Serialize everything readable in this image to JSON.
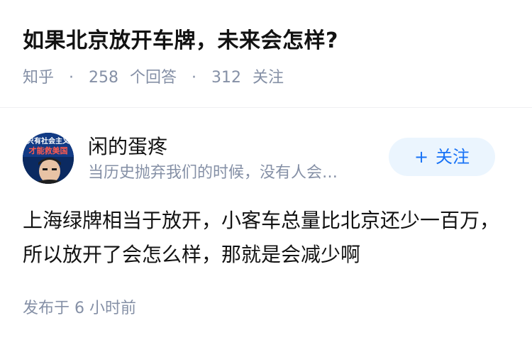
{
  "question": {
    "title": "如果北京放开车牌，未来会怎样?",
    "source": "知乎",
    "separator": "·",
    "answer_count": "258",
    "answer_label": "个回答",
    "follower_count": "312",
    "follower_label": "关注"
  },
  "answer": {
    "author_name": "闲的蛋疼",
    "author_bio": "当历史抛弃我们的时候，没有人会…",
    "avatar_text_line1": "只有社会主义",
    "avatar_text_line2": "才能救美国",
    "follow_plus": "+",
    "follow_label": "关注",
    "content": "上海绿牌相当于放开，小客车总量比北京还少一百万，所以放开了会怎么样，那就是会减少啊",
    "time": "发布于 6 小时前"
  },
  "colors": {
    "title": "#121212",
    "meta": "#8590a6",
    "accent": "#1772f6",
    "follow_bg": "#ebf5fe"
  }
}
